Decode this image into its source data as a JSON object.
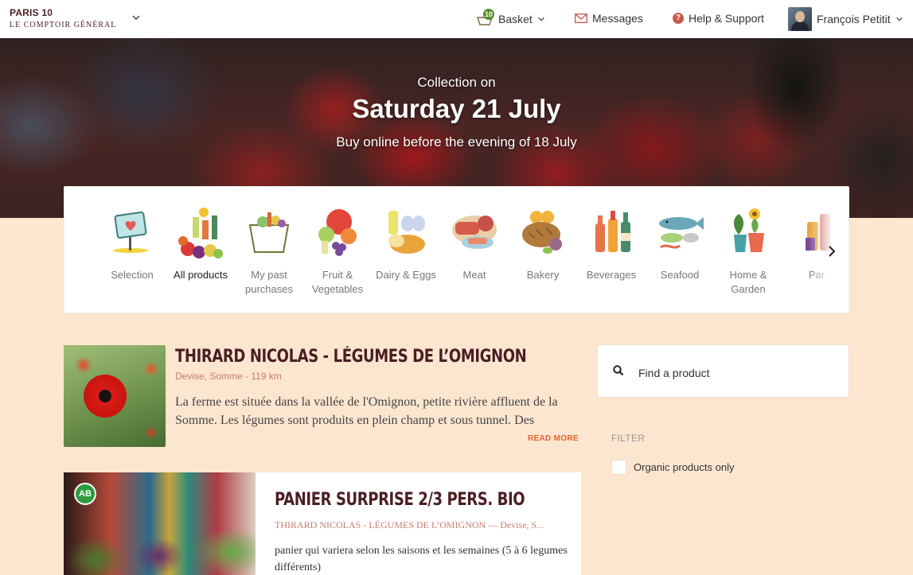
{
  "header": {
    "brand_city": "PARIS 10",
    "brand_sub": "LE COMPTOIR GÉNÉRAL",
    "basket_label": "Basket",
    "basket_count": "10",
    "messages_label": "Messages",
    "help_label": "Help & Support",
    "user_name": "François Petitit"
  },
  "hero": {
    "pre": "Collection on",
    "date": "Saturday 21 July",
    "sub": "Buy online before the evening of 18 July"
  },
  "categories": [
    {
      "label": "Selection",
      "icon": "selection-sign-icon"
    },
    {
      "label": "All products",
      "icon": "all-products-icon",
      "active": true
    },
    {
      "label": "My past purchases",
      "icon": "shopping-bag-icon"
    },
    {
      "label": "Fruit & Vegetables",
      "icon": "fruit-vegetables-icon"
    },
    {
      "label": "Dairy & Eggs",
      "icon": "dairy-eggs-icon"
    },
    {
      "label": "Meat",
      "icon": "meat-icon"
    },
    {
      "label": "Bakery",
      "icon": "bread-icon"
    },
    {
      "label": "Beverages",
      "icon": "bottles-icon"
    },
    {
      "label": "Seafood",
      "icon": "fish-icon"
    },
    {
      "label": "Home & Garden",
      "icon": "plants-icon"
    },
    {
      "label": "Par",
      "icon": "pantry-icon"
    }
  ],
  "producer": {
    "title": "THIRARD NICOLAS - LÉGUMES DE L’OMIGNON",
    "location": "Devise, Somme - 119 km",
    "description": "La ferme est située dans la vallée de l'Omignon, petite rivière affluent de la Somme. Les légumes sont produits en plein champ et sous tunnel. Des",
    "read_more": "READ MORE"
  },
  "product": {
    "badge": "AB",
    "title": "PANIER SURPRISE 2/3 PERS. BIO",
    "subtitle": "THIRARD NICOLAS - LÉGUMES DE L’OMIGNON — Devise, S...",
    "description": "panier qui variera selon les saisons et les semaines (5 à 6 legumes différents)"
  },
  "sidebar": {
    "search_placeholder": "Find a product",
    "filter_heading": "FILTER",
    "organic_label": "Organic products only"
  },
  "colors": {
    "page_bg": "#fde6cf",
    "brand": "#4a1e24",
    "accent": "#e2602c",
    "muted_link": "#c77e6f",
    "organic_green": "#2e9c3e"
  }
}
